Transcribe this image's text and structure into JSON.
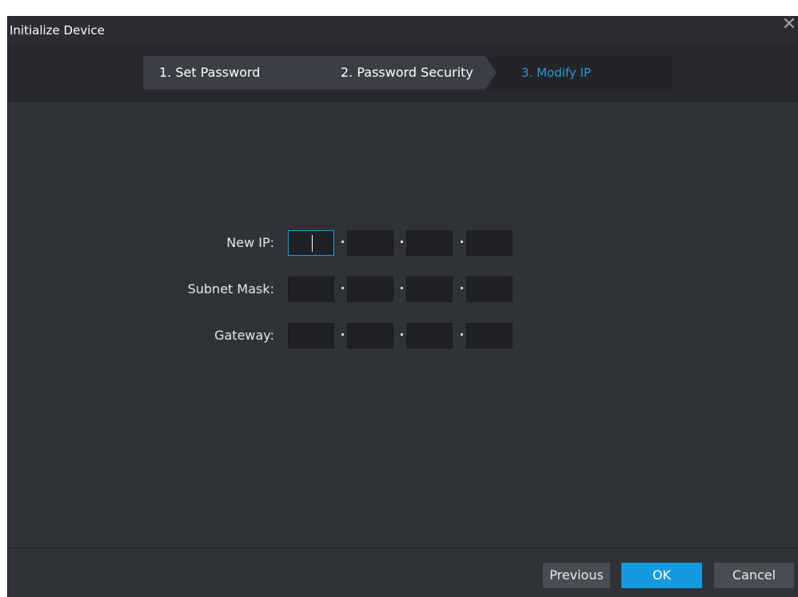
{
  "window": {
    "title": "Initialize Device",
    "close_icon": "close-icon"
  },
  "steps": [
    {
      "label": "1. Set Password",
      "state": "done"
    },
    {
      "label": "2. Password Security",
      "state": "done"
    },
    {
      "label": "3. Modify IP",
      "state": "active"
    }
  ],
  "form": {
    "new_ip": {
      "label": "New IP:",
      "octets": [
        "",
        "",
        "",
        ""
      ]
    },
    "subnet_mask": {
      "label": "Subnet Mask:",
      "octets": [
        "",
        "",
        "",
        ""
      ]
    },
    "gateway": {
      "label": "Gateway:",
      "octets": [
        "",
        "",
        "",
        ""
      ]
    }
  },
  "buttons": {
    "previous": "Previous",
    "ok": "OK",
    "cancel": "Cancel"
  },
  "colors": {
    "accent": "#159ae0",
    "active_step_text": "#2b9ad8",
    "background": "#2f3237"
  }
}
